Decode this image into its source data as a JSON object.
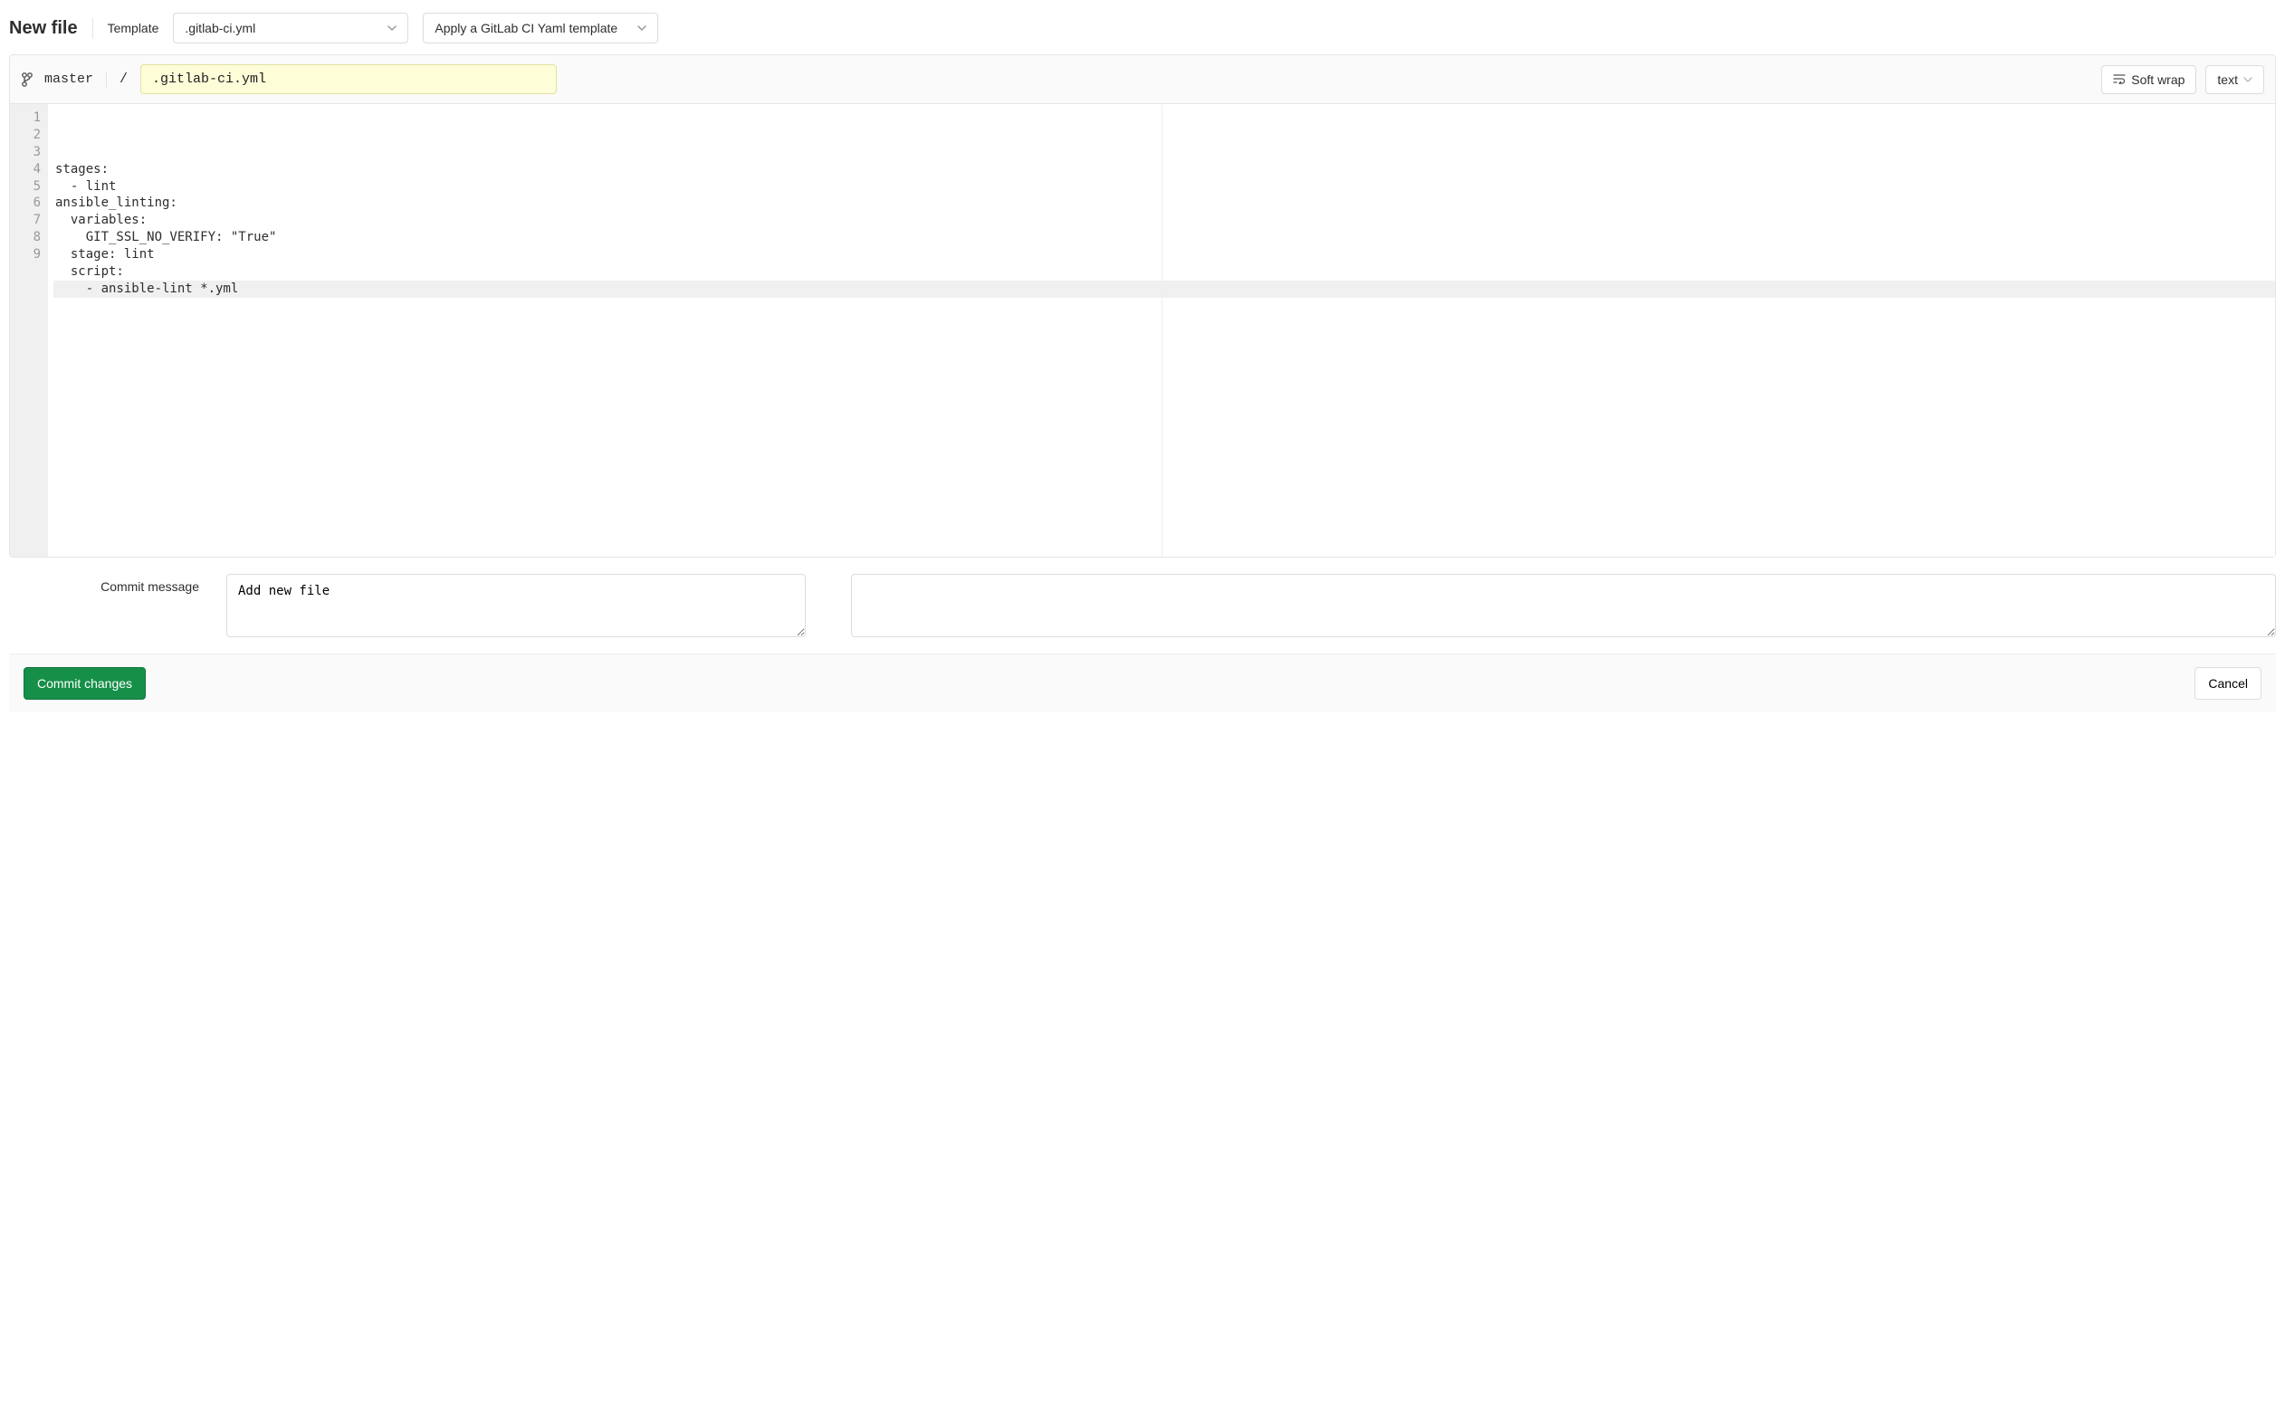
{
  "header": {
    "page_title": "New file",
    "template_label": "Template",
    "template_select_value": ".gitlab-ci.yml",
    "apply_select_value": "Apply a GitLab CI Yaml template"
  },
  "editor_top": {
    "branch": "master",
    "path_separator": "/",
    "filename_value": ".gitlab-ci.yml",
    "softwrap_label": "Soft wrap",
    "syntax_select_value": "text"
  },
  "editor": {
    "line_numbers": [
      "1",
      "2",
      "3",
      "4",
      "5",
      "6",
      "7",
      "8",
      "9"
    ],
    "lines": [
      "stages:",
      "  - lint",
      "",
      "ansible_linting:",
      "  variables:",
      "    GIT_SSL_NO_VERIFY: \"True\"",
      "  stage: lint",
      "  script:",
      "    - ansible-lint *.yml"
    ],
    "current_line_index": 8
  },
  "commit": {
    "label": "Commit message",
    "message_value": "Add new file"
  },
  "footer": {
    "commit_button": "Commit changes",
    "cancel_button": "Cancel"
  }
}
